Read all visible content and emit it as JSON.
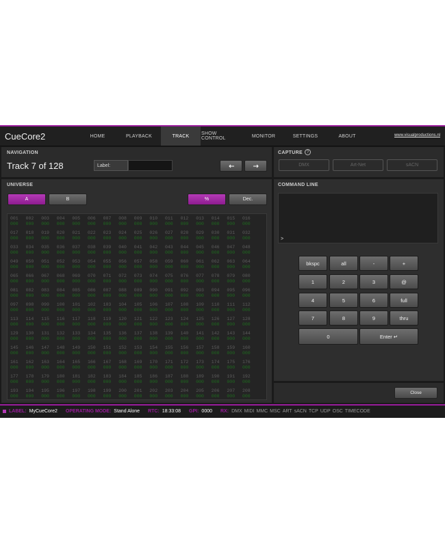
{
  "app": {
    "title": "CueCore2",
    "website": "www.visualproductions.nl",
    "accent": "#9a1c9c",
    "nav": [
      {
        "label": "HOME",
        "active": false
      },
      {
        "label": "PLAYBACK",
        "active": false
      },
      {
        "label": "TRACK",
        "active": true
      },
      {
        "label": "SHOW CONTROL",
        "active": false
      },
      {
        "label": "MONITOR",
        "active": false
      },
      {
        "label": "SETTINGS",
        "active": false
      },
      {
        "label": "ABOUT",
        "active": false
      }
    ]
  },
  "navigation": {
    "title": "NAVIGATION",
    "track_text": "Track 7 of 128",
    "label_caption": "Label:",
    "label_value": "",
    "prev_icon": "arrow-left-icon",
    "next_icon": "arrow-right-icon"
  },
  "capture": {
    "title": "CAPTURE",
    "help_icon": "question-icon",
    "buttons": [
      "DMX",
      "Art-Net",
      "sACN"
    ]
  },
  "universe": {
    "title": "UNIVERSE",
    "buttons": {
      "a": "A",
      "b": "B",
      "percent": "%",
      "dec": "Dec."
    },
    "default_value": "000",
    "channel_start": 1,
    "channel_end": 208,
    "columns": 16
  },
  "command_line": {
    "title": "COMMAND LINE",
    "prompt": ">",
    "keys": [
      "bkspc",
      "all",
      "-",
      "+",
      "1",
      "2",
      "3",
      "@",
      "4",
      "5",
      "6",
      "full",
      "7",
      "8",
      "9",
      "thru",
      "0",
      "Enter ↵"
    ],
    "close_label": "Close"
  },
  "status": {
    "label_caption": "LABEL:",
    "label_value": "MyCueCore2",
    "mode_caption": "OPERATING MODE:",
    "mode_value": "Stand Alone",
    "rtc_caption": "RTC:",
    "rtc_value": "18:33:08",
    "gpi_caption": "GPI:",
    "gpi_value": "0000",
    "rx_caption": "RX:",
    "rx_items": [
      "DMX",
      "MIDI",
      "MMC",
      "MSC",
      "ART",
      "sACN",
      "TCP",
      "UDP",
      "OSC",
      "TIMECODE"
    ]
  }
}
